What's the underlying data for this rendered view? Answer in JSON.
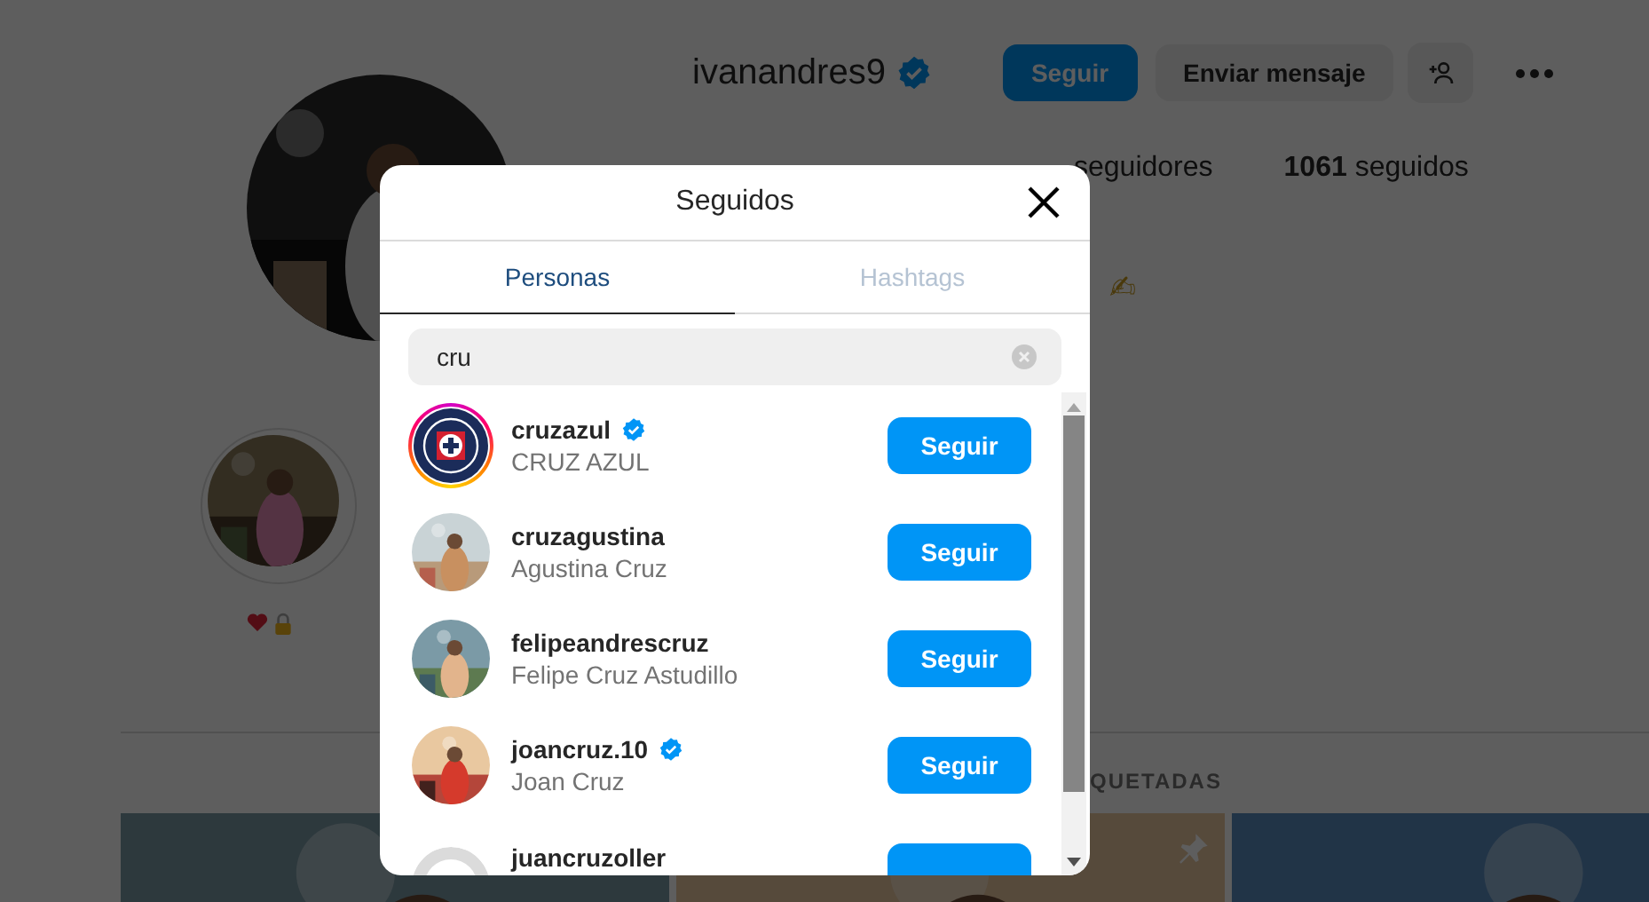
{
  "profile": {
    "username": "ivanandres9",
    "verified": true,
    "actions": [
      {
        "kind": "primary",
        "label": "Seguir"
      },
      {
        "kind": "secondary",
        "label": "Enviar mensaje"
      }
    ],
    "stats": [
      {
        "label": "seguidores"
      },
      {
        "count": "1061",
        "label": "seguidos"
      }
    ],
    "bio": "✍"
  },
  "highlights": [
    {
      "kind": "picture"
    }
  ],
  "profile_tab": "QUETADAS",
  "posts": [
    {
      "kind": "picture"
    },
    {
      "kind": "picture",
      "pinned": true
    },
    {
      "kind": "picture"
    }
  ],
  "modal": {
    "title": "Seguidos",
    "tabs": [
      {
        "label": "Personas",
        "selected": true
      },
      {
        "label": "Hashtags",
        "selected": false
      }
    ],
    "search": {
      "value": "cru"
    },
    "users": [
      {
        "kind": "logo",
        "username": "cruzazul",
        "name": "CRUZ AZUL",
        "verified": true,
        "story": true,
        "button": "Seguir"
      },
      {
        "kind": "picture",
        "username": "cruzagustina",
        "name": "Agustina Cruz",
        "verified": false,
        "story": false,
        "button": "Seguir"
      },
      {
        "kind": "picture",
        "username": "felipeandrescruz",
        "name": "Felipe Cruz Astudillo",
        "verified": false,
        "story": false,
        "button": "Seguir"
      },
      {
        "kind": "picture",
        "username": "joancruz.10",
        "name": "Joan Cruz",
        "verified": true,
        "story": false,
        "button": "Seguir"
      },
      {
        "kind": "blank",
        "username": "juancruzoller",
        "verified": false,
        "story": false
      }
    ]
  }
}
